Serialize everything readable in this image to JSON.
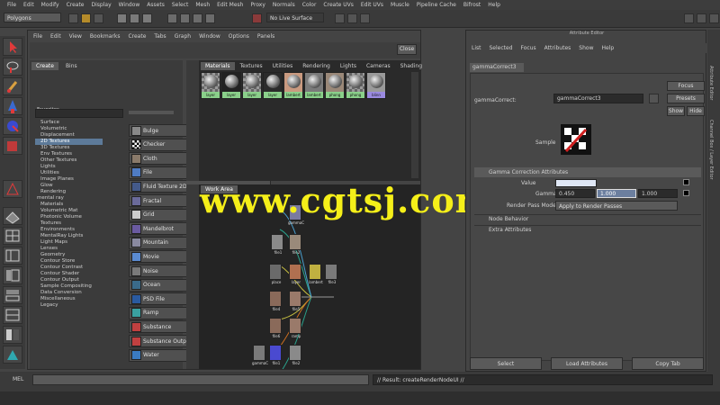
{
  "menubar": [
    "File",
    "Edit",
    "Modify",
    "Create",
    "Display",
    "Window",
    "Assets",
    "Select",
    "Mesh",
    "Edit Mesh",
    "Proxy",
    "Normals",
    "Color",
    "Create UVs",
    "Edit UVs",
    "Muscle",
    "Pipeline Cache",
    "Bifrost",
    "Help"
  ],
  "toolbar": {
    "mode": "Polygons",
    "live_label": "No Live Surface"
  },
  "hypershade": {
    "menus": [
      "File",
      "Edit",
      "View",
      "Bookmarks",
      "Create",
      "Tabs",
      "Graph",
      "Window",
      "Options",
      "Panels"
    ],
    "create_tab": "Create",
    "bins_tab": "Bins",
    "tree": [
      "Favorites",
      "Maya",
      "Surface",
      "Volumetric",
      "Displacement",
      "2D Textures",
      "3D Textures",
      "Env Textures",
      "Other Textures",
      "Lights",
      "Utilities",
      "Image Planes",
      "Glow",
      "Rendering",
      "mental ray",
      "Materials",
      "Volumetric Mat",
      "Photonic Volume",
      "Textures",
      "Environments",
      "MentalRay Lights",
      "Light Maps",
      "Lenses",
      "Geometry",
      "Contour Store",
      "Contour Contrast",
      "Contour Shader",
      "Contour Output",
      "Sample Compositing",
      "Data Conversion",
      "Miscellaneous",
      "Legacy"
    ],
    "selected_tree_item": "2D Textures",
    "nodes": [
      "Bulge",
      "Checker",
      "Cloth",
      "File",
      "Fluid Texture 2D",
      "Fractal",
      "Grid",
      "Mandelbrot",
      "Mountain",
      "Movie",
      "Noise",
      "Ocean",
      "PSD File",
      "Ramp",
      "Substance",
      "Substance Output",
      "Water"
    ],
    "top_tabs": [
      "Materials",
      "Textures",
      "Utilities",
      "Rendering",
      "Lights",
      "Cameras",
      "Shading"
    ],
    "swatch_labels": [
      "layer",
      "layer",
      "layer",
      "layer",
      "lambert",
      "lambert",
      "phong",
      "phong",
      "blinn"
    ],
    "work_tab": "Work Area",
    "graph_nodes": [
      "gammaC",
      "file1",
      "file2",
      "place",
      "layer",
      "lambert",
      "file3",
      "file4",
      "file5",
      "file6",
      "ramp"
    ]
  },
  "attr": {
    "header": "Attribute Editor",
    "menus": [
      "List",
      "Selected",
      "Focus",
      "Attributes",
      "Show",
      "Help"
    ],
    "node_tab": "gammaCorrect3",
    "type_label": "gammaCorrect:",
    "name_value": "gammaCorrect3",
    "focus": "Focus",
    "presets": "Presets",
    "show": "Show",
    "hide": "Hide",
    "sample": "Sample",
    "section": "Gamma Correction Attributes",
    "value_label": "Value",
    "gamma_label": "Gamma",
    "gamma": [
      "0.450",
      "1.000",
      "1.000"
    ],
    "render_pass_label": "Render Pass Mode",
    "render_pass_value": "Apply to Render Passes",
    "node_behavior": "Node Behavior",
    "extra": "Extra Attributes",
    "select_btn": "Select",
    "load_btn": "Load Attributes",
    "copy_btn": "Copy Tab",
    "side_tabs": [
      "Attribute Editor",
      "Channel Box / Layer Editor"
    ]
  },
  "status": {
    "mel": "MEL",
    "result": "// Result: createRenderNodeUI //"
  },
  "watermark": "www.cgtsj.com"
}
